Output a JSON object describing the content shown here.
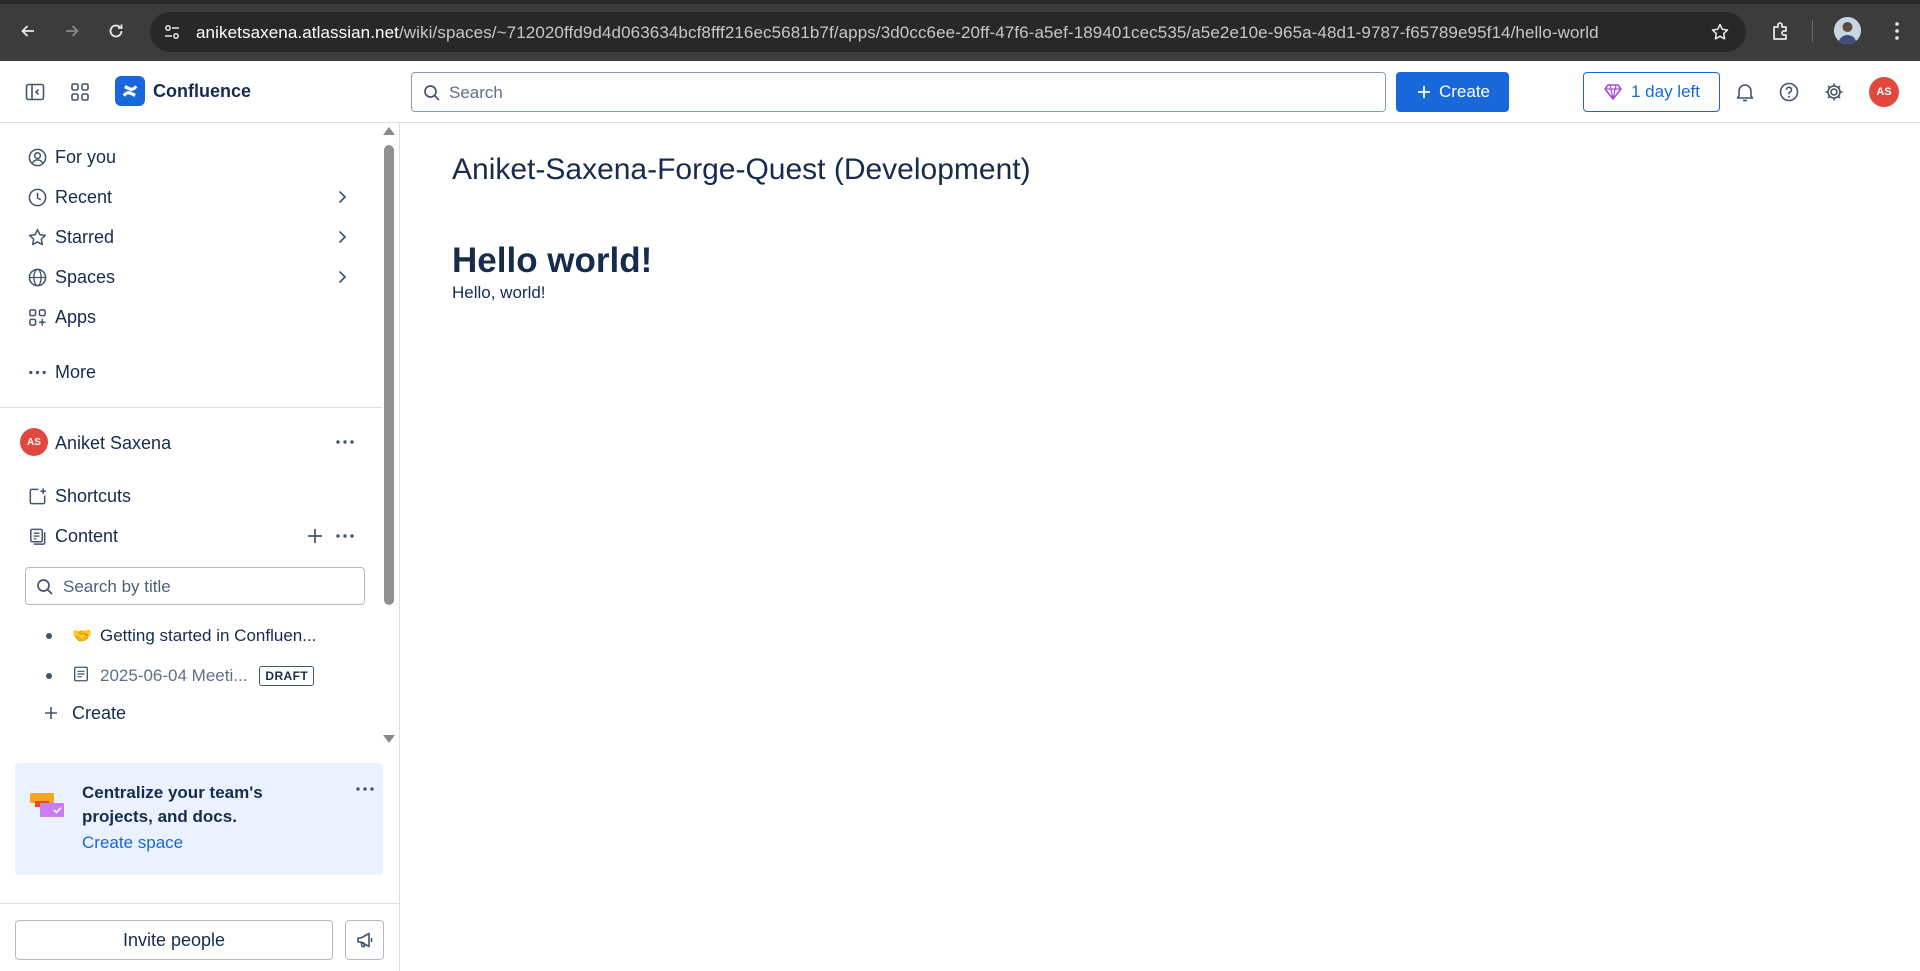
{
  "browser": {
    "url_host": "aniketsaxena.atlassian.net",
    "url_path": "/wiki/spaces/~712020ffd9d4d063634bcf8fff216ec5681b7f/apps/3d0cc6ee-20ff-47f6-a5ef-189401cec535/a5e2e10e-965a-48d1-9787-f65789e95f14/hello-world"
  },
  "header": {
    "product_name": "Confluence",
    "search_placeholder": "Search",
    "create_label": "Create",
    "trial_label": "1 day left",
    "avatar_initials": "AS",
    "brand_color": "#1868db",
    "avatar_color": "#e2483d"
  },
  "sidebar": {
    "nav": [
      {
        "label": "For you",
        "icon": "person-circle-icon"
      },
      {
        "label": "Recent",
        "icon": "clock-icon"
      },
      {
        "label": "Starred",
        "icon": "star-icon"
      },
      {
        "label": "Spaces",
        "icon": "globe-icon"
      },
      {
        "label": "Apps",
        "icon": "apps-icon"
      },
      {
        "label": "More",
        "icon": "more-icon"
      }
    ],
    "space": {
      "avatar_initials": "AS",
      "name": "Aniket Saxena"
    },
    "shortcuts_label": "Shortcuts",
    "content_label": "Content",
    "search_placeholder": "Search by title",
    "tree": [
      {
        "emoji": "🤝",
        "label": "Getting started in Confluen..."
      },
      {
        "label": "2025-06-04 Meeti...",
        "badge": "DRAFT"
      }
    ],
    "tree_create_label": "Create",
    "promo": {
      "heading": "Centralize your team's projects, and docs.",
      "link": "Create space"
    },
    "invite_label": "Invite people"
  },
  "main": {
    "app_title": "Aniket-Saxena-Forge-Quest (Development)",
    "heading": "Hello world!",
    "body": "Hello, world!"
  }
}
